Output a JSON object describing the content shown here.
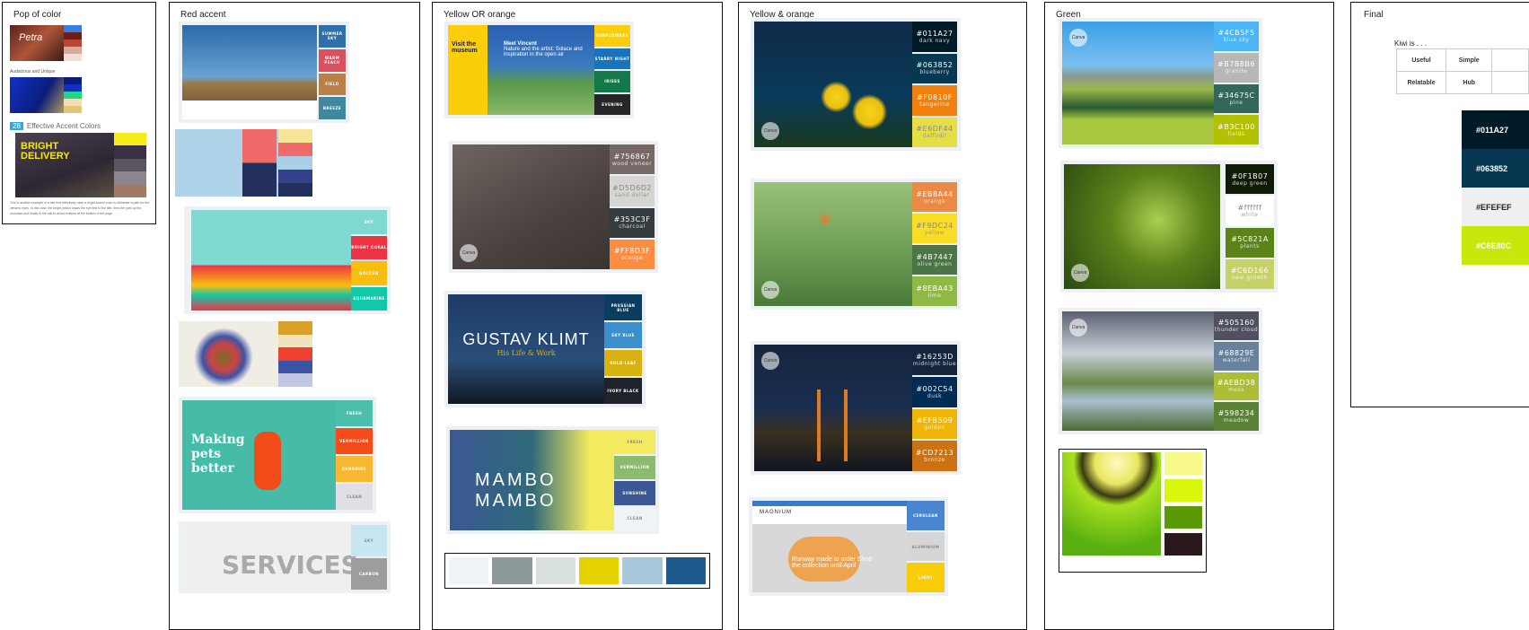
{
  "frames": {
    "pop": {
      "title": "Pop of color",
      "sub1": "Audacious and Unique",
      "num": "28",
      "sub2": "Effective Accent Colors",
      "bright": "BRIGHT DELIVERY",
      "petra": "Petra",
      "caption": "This is another example of a site that effectively uses a bright accent color to delineate a path for the viewers' eyes. In this case, the bright yellow draws the eye first to the title, then the path up the mountain and finally to the call-to-action buttons at the bottom of the page."
    },
    "red": {
      "title": "Red accent",
      "pets": "Making pets better",
      "services": "SERVICES"
    },
    "yo": {
      "title": "Yellow OR orange",
      "visit": "Visit the museum",
      "meet": "Meet Vincent",
      "nature": "Nature and the artist: Solace and inspiration in the open air",
      "klimt": "GUSTAV KLIMT",
      "klimt_sub": "His Life & Work",
      "mambo": "MAMBO MAMBO"
    },
    "ya": {
      "title": "Yellow & orange",
      "magnium": "MAGNIUM",
      "runway": "Runway made to order Shop the collection until April"
    },
    "green": {
      "title": "Green"
    },
    "final": {
      "title": "Final",
      "kiwi": "Kiwi is . . .",
      "table": [
        [
          "Useful",
          "Simple"
        ],
        [
          "Relatable",
          "Hub"
        ]
      ],
      "swatches": [
        {
          "hex": "#011A27",
          "label": "#011A27",
          "text": "#ffffff"
        },
        {
          "hex": "#063852",
          "label": "#063852",
          "text": "#ffffff"
        },
        {
          "hex": "#EFEFEF",
          "label": "#EFEFEF",
          "text": "#222222"
        },
        {
          "hex": "#C8E80C",
          "label": "#C8E80C",
          "text": "#ffffff"
        }
      ]
    }
  },
  "brand_mark": "Canva",
  "palettes": {
    "pop1": [
      {
        "c": "#3b7de0"
      },
      {
        "c": "#6a2016"
      },
      {
        "c": "#b84536"
      },
      {
        "c": "#d9a89a"
      },
      {
        "c": "#f2dcd6"
      }
    ],
    "pop2": [
      {
        "c": "#0b1d7a"
      },
      {
        "c": "#1030c8"
      },
      {
        "c": "#21d58d"
      },
      {
        "c": "#f2dfb3"
      },
      {
        "c": "#e2c47a"
      }
    ],
    "pop3": [
      {
        "c": "#f7ec1a"
      },
      {
        "c": "#3a3045"
      },
      {
        "c": "#58555c"
      },
      {
        "c": "#8b8590"
      },
      {
        "c": "#a07a66"
      }
    ],
    "r1": [
      {
        "c": "#2f6fab",
        "h": "SUMMER SKY"
      },
      {
        "c": "#d9505f",
        "h": "WARM PEACH"
      },
      {
        "c": "#b98149",
        "h": "FIELD"
      },
      {
        "c": "#3f88a0",
        "h": "BREEZE"
      }
    ],
    "r2": [
      {
        "c": "#f6e597"
      },
      {
        "c": "#f06a6a"
      },
      {
        "c": "#a9d0e8"
      },
      {
        "c": "#33418a"
      },
      {
        "c": "#23305e"
      }
    ],
    "r3": [
      {
        "c": "#7fd8d2",
        "h": "SKY"
      },
      {
        "c": "#ee3344",
        "h": "BRIGHT CORAL"
      },
      {
        "c": "#f9bd0e",
        "h": "GOLDEN"
      },
      {
        "c": "#11c9a9",
        "h": "AQUAMARINE"
      }
    ],
    "r4": [
      {
        "c": "#d9a02a"
      },
      {
        "c": "#f0e2bb"
      },
      {
        "c": "#ef4130"
      },
      {
        "c": "#3d53a5"
      },
      {
        "c": "#c2c8e3"
      }
    ],
    "r5": [
      {
        "c": "#4bbfab",
        "h": "FRESH"
      },
      {
        "c": "#f44b1a",
        "h": "VERMILLION"
      },
      {
        "c": "#f7b731",
        "h": "SUNSHINE"
      },
      {
        "c": "#e0dfe6",
        "h": "CLEAN"
      }
    ],
    "r6": [
      {
        "c": "#c7e6f1",
        "h": "SKY"
      },
      {
        "c": "#9d9d9d",
        "h": "CARBON"
      }
    ],
    "y1": [
      {
        "c": "#fbcd0a",
        "h": "SUNFLOWERS"
      },
      {
        "c": "#1a73b8",
        "h": "STARRY NIGHT"
      },
      {
        "c": "#14784a",
        "h": "IRISES"
      },
      {
        "c": "#262528",
        "h": "EVENING"
      }
    ],
    "y2": [
      {
        "c": "#756867",
        "h": "#756867",
        "n": "wood veneer"
      },
      {
        "c": "#D5D6D2",
        "h": "#D5D6D2",
        "n": "sand dollar"
      },
      {
        "c": "#353C3F",
        "h": "#353C3F",
        "n": "charcoal"
      },
      {
        "c": "#FF8D3F",
        "h": "#FF8D3F",
        "n": "orange"
      }
    ],
    "y3": [
      {
        "c": "#0b3d5e",
        "h": "PRUSSIAN BLUE"
      },
      {
        "c": "#3a8fcc",
        "h": "SKY BLUE"
      },
      {
        "c": "#d8b211",
        "h": "GOLD LEAF"
      },
      {
        "c": "#1d222b",
        "h": "IVORY BLACK"
      }
    ],
    "y4": [
      {
        "c": "#f3ea5f",
        "h": "FRESH"
      },
      {
        "c": "#8cba6e",
        "h": "VERMILLION"
      },
      {
        "c": "#3b5894",
        "h": "SUNSHINE"
      },
      {
        "c": "#eef3f5",
        "h": "CLEAN"
      }
    ],
    "strip": [
      "#eef3f6",
      "#8e9a9a",
      "#d8e0df",
      "#e5d000",
      "#a7c8da",
      "#1f5a8c"
    ],
    "a1": [
      {
        "c": "#011A27",
        "h": "#011A27",
        "n": "dark navy"
      },
      {
        "c": "#063852",
        "h": "#063852",
        "n": "blueberry"
      },
      {
        "c": "#F0810F",
        "h": "#F0810F",
        "n": "tangerine"
      },
      {
        "c": "#E6DF44",
        "h": "#E6DF44",
        "n": "daffodil"
      }
    ],
    "a2": [
      {
        "c": "#EB8A44",
        "h": "#EB8A44",
        "n": "orange"
      },
      {
        "c": "#F9DC24",
        "h": "#F9DC24",
        "n": "yellow"
      },
      {
        "c": "#4B7447",
        "h": "#4B7447",
        "n": "olive green"
      },
      {
        "c": "#8EBA43",
        "h": "#8EBA43",
        "n": "lime"
      }
    ],
    "a3": [
      {
        "c": "#16253D",
        "h": "#16253D",
        "n": "midnight blue"
      },
      {
        "c": "#002C54",
        "h": "#002C54",
        "n": "dusk"
      },
      {
        "c": "#EFB509",
        "h": "#EFB509",
        "n": "golden"
      },
      {
        "c": "#CD7213",
        "h": "#CD7213",
        "n": "bronze"
      }
    ],
    "a4": [
      {
        "c": "#4a86d0",
        "h": "CERULEAN"
      },
      {
        "c": "#d6d6d6",
        "h": "ALUMINIUM"
      },
      {
        "c": "#f9cc0a",
        "h": "LIGHT"
      }
    ],
    "g1": [
      {
        "c": "#4CB5F5",
        "h": "#4CB5F5",
        "n": "blue sky"
      },
      {
        "c": "#B7B8B6",
        "h": "#B7B8B6",
        "n": "granite"
      },
      {
        "c": "#34675C",
        "h": "#34675C",
        "n": "pine"
      },
      {
        "c": "#B3C100",
        "h": "#B3C100",
        "n": "fields"
      }
    ],
    "g2": [
      {
        "c": "#0F1B07",
        "h": "#0F1B07",
        "n": "deep green"
      },
      {
        "c": "#ffffff",
        "h": "#ffffff",
        "n": "white"
      },
      {
        "c": "#5C821A",
        "h": "#5C821A",
        "n": "plants"
      },
      {
        "c": "#C6D166",
        "h": "#C6D166",
        "n": "new growth"
      }
    ],
    "g3": [
      {
        "c": "#505160",
        "h": "#505160",
        "n": "thunder cloud"
      },
      {
        "c": "#68829E",
        "h": "#68829E",
        "n": "waterfall"
      },
      {
        "c": "#AEBD38",
        "h": "#AEBD38",
        "n": "moss"
      },
      {
        "c": "#598234",
        "h": "#598234",
        "n": "meadow"
      }
    ],
    "g4": [
      {
        "c": "#f7f98a"
      },
      {
        "c": "#d9f70a"
      },
      {
        "c": "#5a9a06"
      },
      {
        "c": "#2a1a1c"
      }
    ]
  }
}
